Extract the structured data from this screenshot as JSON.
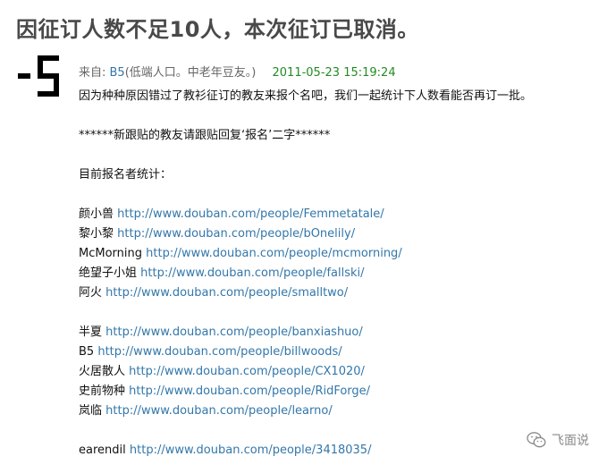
{
  "post": {
    "title": "因征订人数不足10人，本次征订已取消。",
    "author": {
      "prefix": "来自: ",
      "name": "B5",
      "signature": "(低端人口。中老年豆友。)"
    },
    "timestamp": "2011-05-23 15:19:24",
    "intro": "因为种种原因错过了教衫征订的教友来报个名吧，我们一起统计下人数看能否再订一批。",
    "notice": "******新跟贴的教友请跟贴回复‘报名’二字******",
    "stats_label": "目前报名者统计：",
    "group1": [
      {
        "name": "颜小兽",
        "url": "http://www.douban.com/people/Femmetatale/"
      },
      {
        "name": "黎小黎",
        "url": "http://www.douban.com/people/bOnelily/"
      },
      {
        "name": "McMorning",
        "url": "http://www.douban.com/people/mcmorning/"
      },
      {
        "name": "绝望子小姐",
        "url": "http://www.douban.com/people/fallski/"
      },
      {
        "name": "阿火",
        "url": "http://www.douban.com/people/smalltwo/"
      }
    ],
    "group2": [
      {
        "name": "半夏",
        "url": "http://www.douban.com/people/banxiashuo/"
      },
      {
        "name": "B5",
        "url": "http://www.douban.com/people/billwoods/"
      },
      {
        "name": "火居散人",
        "url": "http://www.douban.com/people/CX1020/"
      },
      {
        "name": "史前物种",
        "url": "http://www.douban.com/people/RidForge/"
      },
      {
        "name": "岚临",
        "url": "http://www.douban.com/people/learno/"
      }
    ],
    "group3": [
      {
        "name": "earendil",
        "url": "http://www.douban.com/people/3418035/"
      }
    ]
  },
  "watermark": {
    "icon": "wechat-icon",
    "text": "飞面说"
  },
  "colors": {
    "title": "#494949",
    "link": "#3377aa",
    "timestamp": "#228b22",
    "meta": "#666666",
    "body": "#111111"
  }
}
